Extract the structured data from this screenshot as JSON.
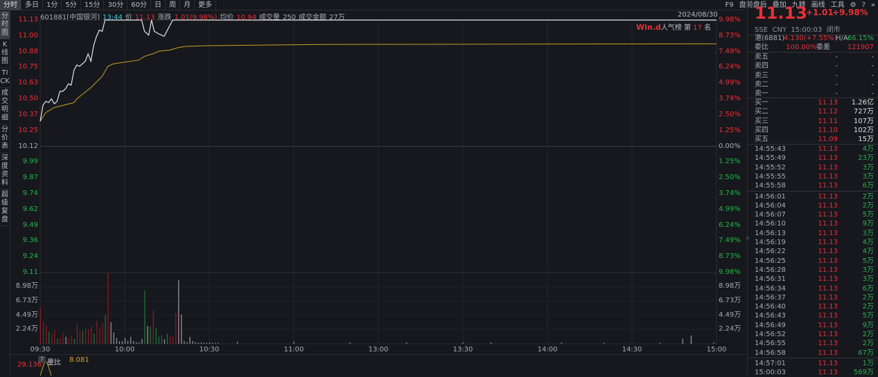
{
  "topbar": {
    "tabs": [
      "分时",
      "多日",
      "1分",
      "5分",
      "15分",
      "30分",
      "60分",
      "日",
      "周",
      "月",
      "更多"
    ],
    "right": [
      "F9",
      "盘前盘后",
      "叠加",
      "九转",
      "画线",
      "工具"
    ],
    "icons": [
      "gear-icon",
      "help-icon",
      "expand-icon"
    ],
    "help": "?",
    "more": "»"
  },
  "sidebar": [
    "分时图",
    "K线图",
    "TICK",
    "成交明细",
    "分价表",
    "深度资料",
    "超级复盘"
  ],
  "info": {
    "code": "601881[中国银河]",
    "time": "13:44",
    "price_label": "价",
    "price": "11.13",
    "chg_label": "涨跌",
    "chg": "1.01(9.98%)",
    "avg_label": "均价",
    "avg": "10.94",
    "vol_label": "成交量",
    "vol": "250",
    "amt_label": "成交金额",
    "amt": "27万"
  },
  "date": "2024/08/30",
  "rank": {
    "brand": "Win.d",
    "label": "人气榜",
    "pre": "第",
    "num": "17",
    "post": "名"
  },
  "axes": {
    "price_left": [
      [
        "11.13",
        "red"
      ],
      [
        "11.00",
        "red"
      ],
      [
        "10.88",
        "red"
      ],
      [
        "10.75",
        "red"
      ],
      [
        "10.63",
        "red"
      ],
      [
        "10.50",
        "red"
      ],
      [
        "10.37",
        "red"
      ],
      [
        "10.25",
        "red"
      ],
      [
        "10.12",
        "gray"
      ],
      [
        "9.99",
        "green"
      ],
      [
        "9.87",
        "green"
      ],
      [
        "9.74",
        "green"
      ],
      [
        "9.62",
        "green"
      ],
      [
        "9.49",
        "green"
      ],
      [
        "9.36",
        "green"
      ],
      [
        "9.24",
        "green"
      ],
      [
        "9.11",
        "green"
      ]
    ],
    "pct_right": [
      [
        "9.98%",
        "red"
      ],
      [
        "8.73%",
        "red"
      ],
      [
        "7.49%",
        "red"
      ],
      [
        "6.24%",
        "red"
      ],
      [
        "4.99%",
        "red"
      ],
      [
        "3.74%",
        "red"
      ],
      [
        "2.50%",
        "red"
      ],
      [
        "1.25%",
        "red"
      ],
      [
        "0.00%",
        "gray"
      ],
      [
        "1.25%",
        "green"
      ],
      [
        "2.50%",
        "green"
      ],
      [
        "3.74%",
        "green"
      ],
      [
        "4.99%",
        "green"
      ],
      [
        "6.24%",
        "green"
      ],
      [
        "7.49%",
        "green"
      ],
      [
        "8.73%",
        "green"
      ],
      [
        "9.98%",
        "green"
      ]
    ],
    "vol": [
      "8.98万",
      "6.73万",
      "4.49万",
      "2.24万"
    ],
    "times": [
      "09:30",
      "10:00",
      "10:30",
      "11:00",
      "13:00",
      "13:30",
      "14:00",
      "14:30",
      "15:00"
    ]
  },
  "chart_data": {
    "type": "line",
    "prev_close": 10.12,
    "ylim": [
      9.11,
      11.13
    ],
    "minutes": 240,
    "vol_max_wan": 11.2,
    "price": [
      [
        0,
        10.32
      ],
      [
        1,
        10.45
      ],
      [
        2,
        10.48
      ],
      [
        3,
        10.47
      ],
      [
        4,
        10.5
      ],
      [
        5,
        10.46
      ],
      [
        6,
        10.48
      ],
      [
        7,
        10.56
      ],
      [
        8,
        10.56
      ],
      [
        9,
        10.58
      ],
      [
        10,
        10.62
      ],
      [
        11,
        10.61
      ],
      [
        12,
        10.73
      ],
      [
        13,
        10.77
      ],
      [
        14,
        10.76
      ],
      [
        16,
        10.8
      ],
      [
        17,
        10.86
      ],
      [
        18,
        10.8
      ],
      [
        19,
        10.93
      ],
      [
        20,
        11.0
      ],
      [
        21,
        11.05
      ],
      [
        22,
        11.04
      ],
      [
        23,
        11.13
      ],
      [
        36,
        11.13
      ],
      [
        37,
        11.04
      ],
      [
        38.5,
        11.01
      ],
      [
        39.5,
        11.13
      ],
      [
        40.5,
        11.04
      ],
      [
        42,
        11.02
      ],
      [
        43,
        11.01
      ],
      [
        44,
        11.0
      ],
      [
        47,
        11.13
      ],
      [
        240,
        11.13
      ]
    ],
    "avg": [
      [
        0,
        10.32
      ],
      [
        2,
        10.39
      ],
      [
        5,
        10.43
      ],
      [
        12,
        10.47
      ],
      [
        13,
        10.5
      ],
      [
        18,
        10.59
      ],
      [
        22,
        10.68
      ],
      [
        24,
        10.76
      ],
      [
        26,
        10.78
      ],
      [
        35,
        10.81
      ],
      [
        37,
        10.84
      ],
      [
        40,
        10.86
      ],
      [
        42,
        10.88
      ],
      [
        46,
        10.89
      ],
      [
        49,
        10.91
      ],
      [
        52,
        10.92
      ],
      [
        60,
        10.925
      ],
      [
        100,
        10.935
      ],
      [
        240,
        10.94
      ]
    ],
    "volume": [
      [
        5.6,
        "r"
      ],
      [
        3.5,
        "r"
      ],
      [
        3.0,
        "r"
      ],
      [
        1.9,
        "g"
      ],
      [
        1.5,
        "r"
      ],
      [
        2.2,
        "r"
      ],
      [
        0.75,
        "g"
      ],
      [
        0.9,
        "r"
      ],
      [
        1.8,
        "r"
      ],
      [
        1.1,
        "w"
      ],
      [
        0.9,
        "r"
      ],
      [
        1.3,
        "r"
      ],
      [
        0.8,
        "g"
      ],
      [
        3.1,
        "r"
      ],
      [
        2.0,
        "r"
      ],
      [
        2.0,
        "g"
      ],
      [
        2.4,
        "r"
      ],
      [
        2.3,
        "r"
      ],
      [
        2.8,
        "r"
      ],
      [
        1.6,
        "g"
      ],
      [
        3.6,
        "r"
      ],
      [
        2.5,
        "r"
      ],
      [
        3.3,
        "r"
      ],
      [
        4.5,
        "g"
      ],
      [
        11.1,
        "r"
      ],
      [
        3.4,
        "w"
      ],
      [
        1.8,
        "w"
      ],
      [
        0.9,
        "w"
      ],
      [
        0.4,
        "w"
      ],
      [
        0.4,
        "w"
      ],
      [
        0.9,
        "w"
      ],
      [
        0.45,
        "w"
      ],
      [
        1.1,
        "w"
      ],
      [
        0.45,
        "w"
      ],
      [
        0.25,
        "w"
      ],
      [
        0.25,
        "w"
      ],
      [
        0.75,
        "w"
      ],
      [
        8.4,
        "g"
      ],
      [
        2.8,
        "w"
      ],
      [
        2.7,
        "g"
      ],
      [
        5.2,
        "r"
      ],
      [
        2.5,
        "g"
      ],
      [
        1.1,
        "g"
      ],
      [
        1.3,
        "g"
      ],
      [
        0.7,
        "w"
      ],
      [
        1.6,
        "g"
      ],
      [
        1.3,
        "r"
      ],
      [
        1.1,
        "r"
      ],
      [
        4.9,
        "r"
      ],
      [
        10.0,
        "w"
      ],
      [
        4.6,
        "w"
      ],
      [
        0.45,
        "w"
      ],
      [
        0.25,
        "w"
      ],
      [
        1.1,
        "w"
      ],
      [
        0.45,
        "w"
      ],
      [
        0.25,
        "w"
      ],
      [
        0.2,
        "w"
      ],
      [
        0.2,
        "w"
      ],
      [
        0.2,
        "w"
      ],
      [
        0.15,
        "w"
      ],
      [
        0.2,
        "w"
      ],
      [
        0.15,
        "w"
      ],
      [
        0.15,
        "w"
      ],
      [
        0.15,
        "w"
      ]
    ],
    "sparse_volume": [
      [
        70,
        0.3
      ],
      [
        90,
        0.3
      ],
      [
        110,
        0.2
      ],
      [
        130,
        0.2
      ],
      [
        150,
        0.2
      ],
      [
        160,
        0.2
      ],
      [
        185,
        0.2
      ],
      [
        200,
        0.15
      ],
      [
        220,
        0.15
      ],
      [
        228,
        0.8
      ],
      [
        231,
        1.3
      ],
      [
        239,
        0.2
      ]
    ]
  },
  "lower": {
    "help": "?",
    "label": "量比",
    "value": "8.081",
    "max": "29.136"
  },
  "right": {
    "price": "11.13",
    "chg": "+1.01",
    "pct": "+9.98%",
    "meta": "SSE  CNY  15:00:03  闭市",
    "hk_label": "港(6881)",
    "hk_val": "4.130(+7.55%)",
    "ha_label": "H/A:",
    "ha_val": "-66.15%",
    "wb_label": "委比",
    "wb_val": "100.00%",
    "wc_label": "委差",
    "wc_val": "121907",
    "asks": [
      [
        "卖五",
        "-",
        "-"
      ],
      [
        "卖四",
        "-",
        "-"
      ],
      [
        "卖三",
        "-",
        "-"
      ],
      [
        "卖二",
        "-",
        "-"
      ],
      [
        "卖一",
        "-",
        "-"
      ]
    ],
    "bids": [
      [
        "买一",
        "11.13",
        "1.26亿"
      ],
      [
        "买二",
        "11.12",
        "727万"
      ],
      [
        "买三",
        "11.11",
        "107万"
      ],
      [
        "买四",
        "11.10",
        "102万"
      ],
      [
        "买五",
        "11.09",
        "15万"
      ]
    ],
    "ticks": [
      [
        "14:55:43",
        "11.13",
        "4万"
      ],
      [
        "14:55:49",
        "11.13",
        "23万"
      ],
      [
        "14:55:52",
        "11.13",
        "3万"
      ],
      [
        "14:55:55",
        "11.13",
        "3万"
      ],
      [
        "14:55:58",
        "11.13",
        "6万"
      ],
      [
        "14:56:01",
        "11.13",
        "2万"
      ],
      [
        "14:56:04",
        "11.13",
        "2万"
      ],
      [
        "14:56:07",
        "11.13",
        "5万"
      ],
      [
        "14:56:10",
        "11.13",
        "9万"
      ],
      [
        "14:56:13",
        "11.13",
        "3万"
      ],
      [
        "14:56:19",
        "11.13",
        "4万"
      ],
      [
        "14:56:22",
        "11.13",
        "4万"
      ],
      [
        "14:56:25",
        "11.13",
        "5万"
      ],
      [
        "14:56:28",
        "11.13",
        "3万"
      ],
      [
        "14:56:31",
        "11.13",
        "3万"
      ],
      [
        "14:56:34",
        "11.13",
        "6万"
      ],
      [
        "14:56:37",
        "11.13",
        "2万"
      ],
      [
        "14:56:40",
        "11.13",
        "2万"
      ],
      [
        "14:56:43",
        "11.13",
        "5万"
      ],
      [
        "14:56:49",
        "11.13",
        "9万"
      ],
      [
        "14:56:52",
        "11.13",
        "2万"
      ],
      [
        "14:56:55",
        "11.13",
        "2万"
      ],
      [
        "14:56:58",
        "11.13",
        "67万"
      ],
      [
        "14:57:01",
        "11.13",
        "1万"
      ],
      [
        "15:00:03",
        "11.13",
        "569万"
      ]
    ]
  },
  "colors": {
    "red": "#e8313a",
    "green": "#2bb24c",
    "white": "#c8cacf",
    "avg": "#c9a227",
    "bg": "#16181d"
  }
}
